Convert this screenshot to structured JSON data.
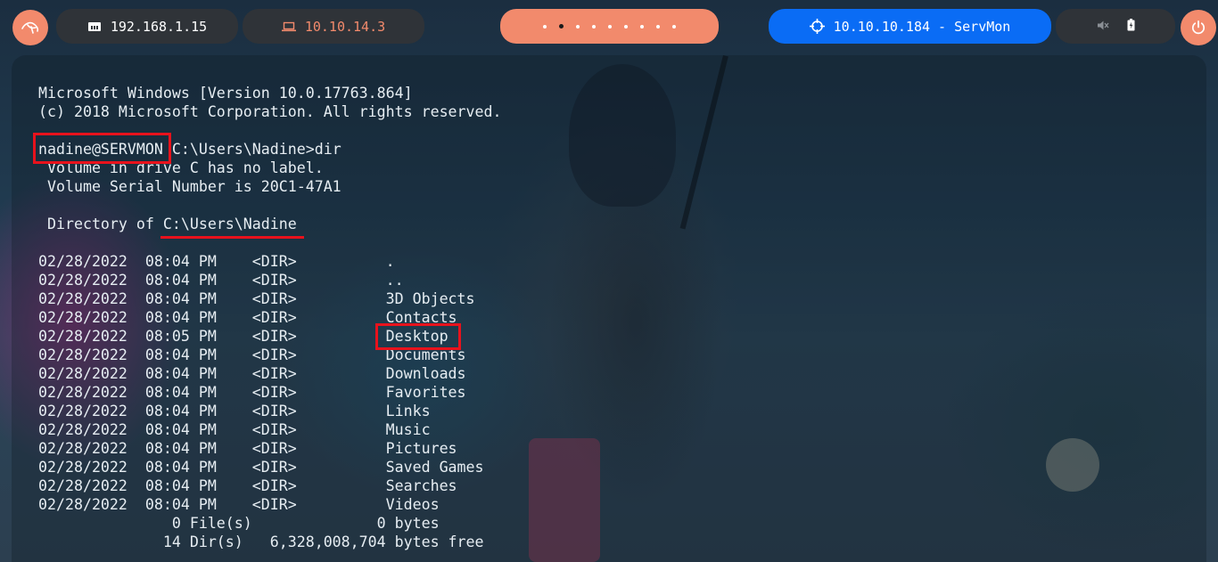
{
  "topbar": {
    "local_ip": "192.168.1.15",
    "vpn_ip": "10.10.14.3",
    "workspace_count": 9,
    "workspace_active_index": 1,
    "target": "10.10.10.184 - ServMon",
    "icons": {
      "launcher": "kali-dragon-icon",
      "local": "ethernet-icon",
      "vpn": "laptop-icon",
      "target": "crosshair-icon",
      "volume": "volume-mute-icon",
      "battery": "battery-icon",
      "power": "power-icon"
    }
  },
  "terminal": {
    "lines": [
      "Microsoft Windows [Version 10.0.17763.864]",
      "(c) 2018 Microsoft Corporation. All rights reserved.",
      "",
      "",
      " Volume in drive C has no label.",
      " Volume Serial Number is 20C1-47A1",
      "",
      "",
      "",
      "02/28/2022  08:04 PM    <DIR>          .",
      "02/28/2022  08:04 PM    <DIR>          ..",
      "02/28/2022  08:04 PM    <DIR>          3D Objects",
      "02/28/2022  08:04 PM    <DIR>          Contacts",
      "02/28/2022  08:05 PM    <DIR>          Desktop",
      "02/28/2022  08:04 PM    <DIR>          Documents",
      "02/28/2022  08:04 PM    <DIR>          Downloads",
      "02/28/2022  08:04 PM    <DIR>          Favorites",
      "02/28/2022  08:04 PM    <DIR>          Links",
      "02/28/2022  08:04 PM    <DIR>          Music",
      "02/28/2022  08:04 PM    <DIR>          Pictures",
      "02/28/2022  08:04 PM    <DIR>          Saved Games",
      "02/28/2022  08:04 PM    <DIR>          Searches",
      "02/28/2022  08:04 PM    <DIR>          Videos",
      "               0 File(s)              0 bytes",
      "              14 Dir(s)   6,328,008,704 bytes free"
    ],
    "prompt_user": "nadine@SERVMON",
    "prompt_path": " C:\\Users\\Nadine>dir",
    "directory_label": " Directory of ",
    "directory_path": "C:\\Users\\Nadine"
  },
  "colors": {
    "accent": "#f28a6c",
    "target_pill": "#0a6cf5",
    "pill_dark": "#2f3338",
    "highlight": "#e8121c",
    "terminal_text": "#e6edf2"
  }
}
